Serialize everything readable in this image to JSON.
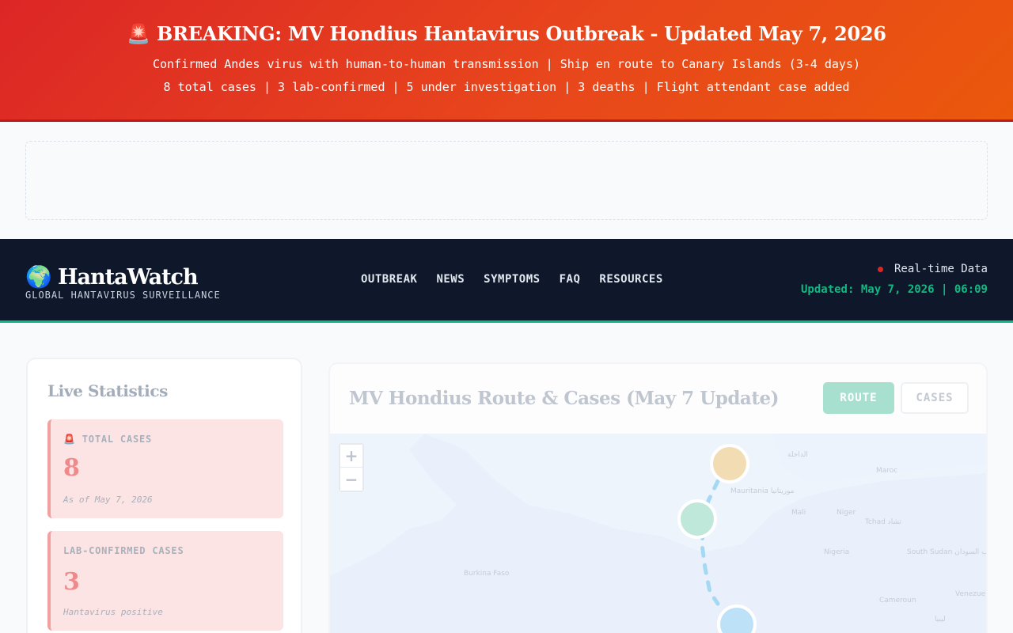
{
  "banner": {
    "headline": "🚨 BREAKING: MV Hondius Hantavirus Outbreak - Updated May 7, 2026",
    "line1": "Confirmed Andes virus with human-to-human transmission | Ship en route to Canary Islands (3-4 days)",
    "line2": "8 total cases | 3 lab-confirmed | 5 under investigation | 3 deaths | Flight attendant case added"
  },
  "nav": {
    "logo": "🌍 HantaWatch",
    "tagline": "GLOBAL HANTAVIRUS SURVEILLANCE",
    "links": [
      "OUTBREAK",
      "NEWS",
      "SYMPTOMS",
      "FAQ",
      "RESOURCES"
    ],
    "live_label": "Real-time Data",
    "updated": "Updated: May 7, 2026 | 06:09"
  },
  "stats": {
    "title": "Live Statistics",
    "cards": [
      {
        "label": "🚨 TOTAL CASES",
        "value": "8",
        "note": "As of May 7, 2026"
      },
      {
        "label": "LAB-CONFIRMED CASES",
        "value": "3",
        "note": "Hantavirus positive"
      }
    ]
  },
  "map": {
    "title": "MV Hondius Route & Cases (May 7 Update)",
    "route_button": "ROUTE",
    "cases_button": "CASES",
    "zoom_in": "+",
    "zoom_out": "−",
    "colors": {
      "marker_start": "#f2dcb4",
      "marker_mid": "#bfe8da",
      "marker_end": "#bde1f7",
      "route_line": "#a5d8f3"
    },
    "places": [
      "الداخلة",
      "Mauritania موريتانيا",
      "Mali",
      "Niger",
      "Tchad تشاد",
      "Burkina Faso",
      "Nigeria",
      "South Sudan جنوب السودان",
      "Cameroun",
      "ليبيا",
      "Maroc",
      "Venezuela"
    ]
  }
}
